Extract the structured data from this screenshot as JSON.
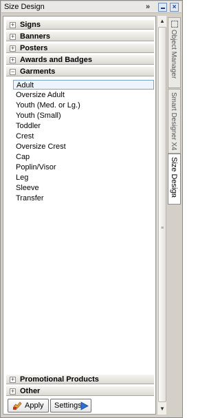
{
  "window": {
    "title": "Size Design",
    "overflow_label": "»"
  },
  "categories_top": [
    {
      "label": "Signs",
      "state": "+"
    },
    {
      "label": "Banners",
      "state": "+"
    },
    {
      "label": "Posters",
      "state": "+"
    },
    {
      "label": "Awards and Badges",
      "state": "+"
    },
    {
      "label": "Garments",
      "state": "−"
    }
  ],
  "garments": [
    {
      "label": "Adult",
      "selected": true
    },
    {
      "label": "Oversize Adult"
    },
    {
      "label": "Youth (Med. or Lg.)"
    },
    {
      "label": "Youth (Small)"
    },
    {
      "label": "Toddler"
    },
    {
      "label": "Crest"
    },
    {
      "label": "Oversize Crest"
    },
    {
      "label": "Cap"
    },
    {
      "label": "Poplin/Visor"
    },
    {
      "label": "Leg"
    },
    {
      "label": "Sleeve"
    },
    {
      "label": "Transfer"
    }
  ],
  "categories_bottom": [
    {
      "label": "Promotional Products",
      "state": "+"
    },
    {
      "label": "Other",
      "state": "+"
    }
  ],
  "buttons": {
    "apply_label": "Apply",
    "settings_label": "Settings"
  },
  "side_tabs": [
    {
      "label": "Object Manager"
    },
    {
      "label": "Smart Designer X4"
    },
    {
      "label": "Size Design",
      "active": true,
      "close": "×"
    }
  ],
  "colors": {
    "selection_border": "#7da2ce",
    "settings_arrow": "#2b6fd6"
  }
}
